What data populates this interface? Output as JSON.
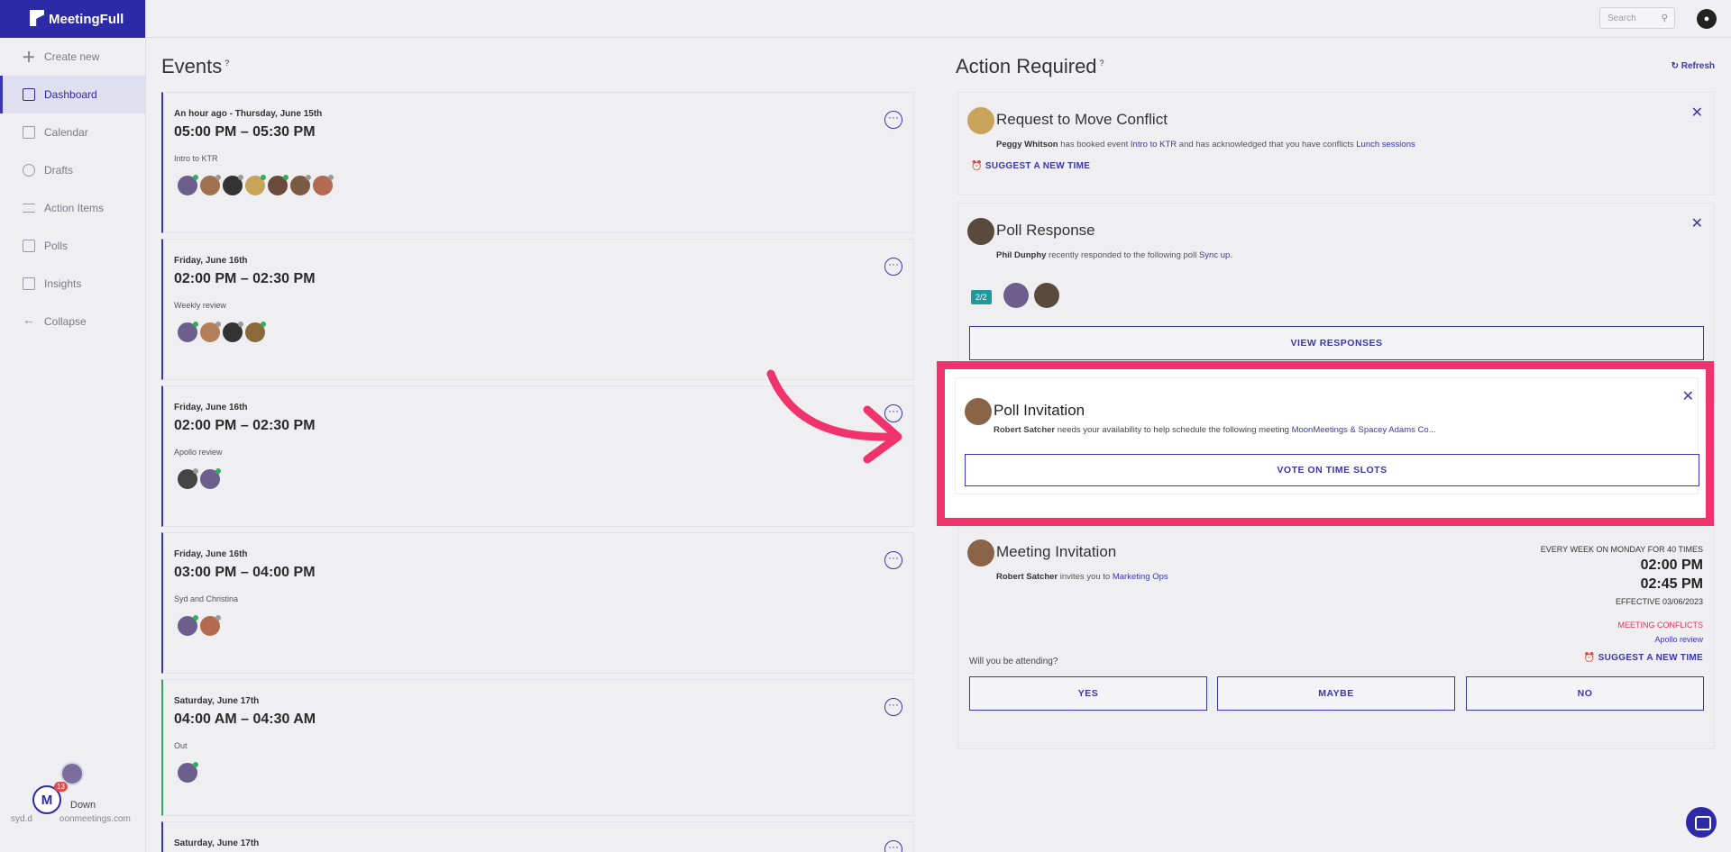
{
  "app": {
    "name": "MeetingFull"
  },
  "nav": [
    {
      "label": "Create new",
      "icon": "plus-icon"
    },
    {
      "label": "Dashboard",
      "icon": "grid-icon",
      "active": true
    },
    {
      "label": "Calendar",
      "icon": "calendar-icon"
    },
    {
      "label": "Drafts",
      "icon": "clock-icon"
    },
    {
      "label": "Action Items",
      "icon": "list-icon"
    },
    {
      "label": "Polls",
      "icon": "poll-icon"
    },
    {
      "label": "Insights",
      "icon": "chart-icon"
    },
    {
      "label": "Collapse",
      "icon": "arrow-left-icon"
    }
  ],
  "user": {
    "name_fragment": "Down",
    "email_fragment": "syd.d",
    "email_tail": "oonmeetings.com",
    "badge": "13",
    "logo_letter": "M"
  },
  "topbar": {
    "search_placeholder": "Search"
  },
  "events": {
    "title": "Events",
    "items": [
      {
        "date": "An hour ago - Thursday, June 15th",
        "time": "05:00 PM – 05:30 PM",
        "title": "Intro to KTR",
        "avatars": 7
      },
      {
        "date": "Friday, June 16th",
        "time": "02:00 PM – 02:30 PM",
        "title": "Weekly review",
        "avatars": 4
      },
      {
        "date": "Friday, June 16th",
        "time": "02:00 PM – 02:30 PM",
        "title": "Apollo review",
        "avatars": 2
      },
      {
        "date": "Friday, June 16th",
        "time": "03:00 PM – 04:00 PM",
        "title": "Syd and Christina",
        "avatars": 2
      },
      {
        "date": "Saturday, June 17th",
        "time": "04:00 AM – 04:30 AM",
        "title": "Out",
        "avatars": 1
      },
      {
        "date": "Saturday, June 17th",
        "time": "",
        "title": "",
        "avatars": 0
      }
    ]
  },
  "actions": {
    "title": "Action Required",
    "refresh": "Refresh",
    "conflict": {
      "title": "Request to Move Conflict",
      "person": "Peggy Whitson",
      "text1": " has booked event ",
      "link1": "Intro to KTR",
      "text2": " and has acknowledged that you have conflicts ",
      "link2": "Lunch sessions",
      "suggest": "SUGGEST A NEW TIME"
    },
    "poll_response": {
      "title": "Poll Response",
      "person": "Phil Dunphy",
      "text": " recently responded to the following poll ",
      "link": "Sync up.",
      "count": "2/2",
      "button": "VIEW RESPONSES"
    },
    "poll_invitation": {
      "title": "Poll Invitation",
      "person": "Robert Satcher",
      "text": " needs your availability to help schedule the following meeting ",
      "link": "MoonMeetings & Spacey Adams Co...",
      "button": "VOTE ON TIME SLOTS"
    },
    "meeting_invitation": {
      "title": "Meeting Invitation",
      "person": "Robert Satcher",
      "text": " invites you to ",
      "link": "Marketing Ops",
      "recurrence": "EVERY WEEK ON MONDAY FOR 40 TIMES",
      "start": "02:00 PM",
      "end": "02:45 PM",
      "effective": "EFFECTIVE 03/06/2023",
      "conflicts": "MEETING CONFLICTS",
      "conflict_link": "Apollo review",
      "question": "Will you be attending?",
      "suggest": "SUGGEST A NEW TIME",
      "yes": "YES",
      "maybe": "MAYBE",
      "no": "NO"
    }
  },
  "colors": {
    "brand": "#2d2aa7",
    "highlight": "#f0336c"
  }
}
